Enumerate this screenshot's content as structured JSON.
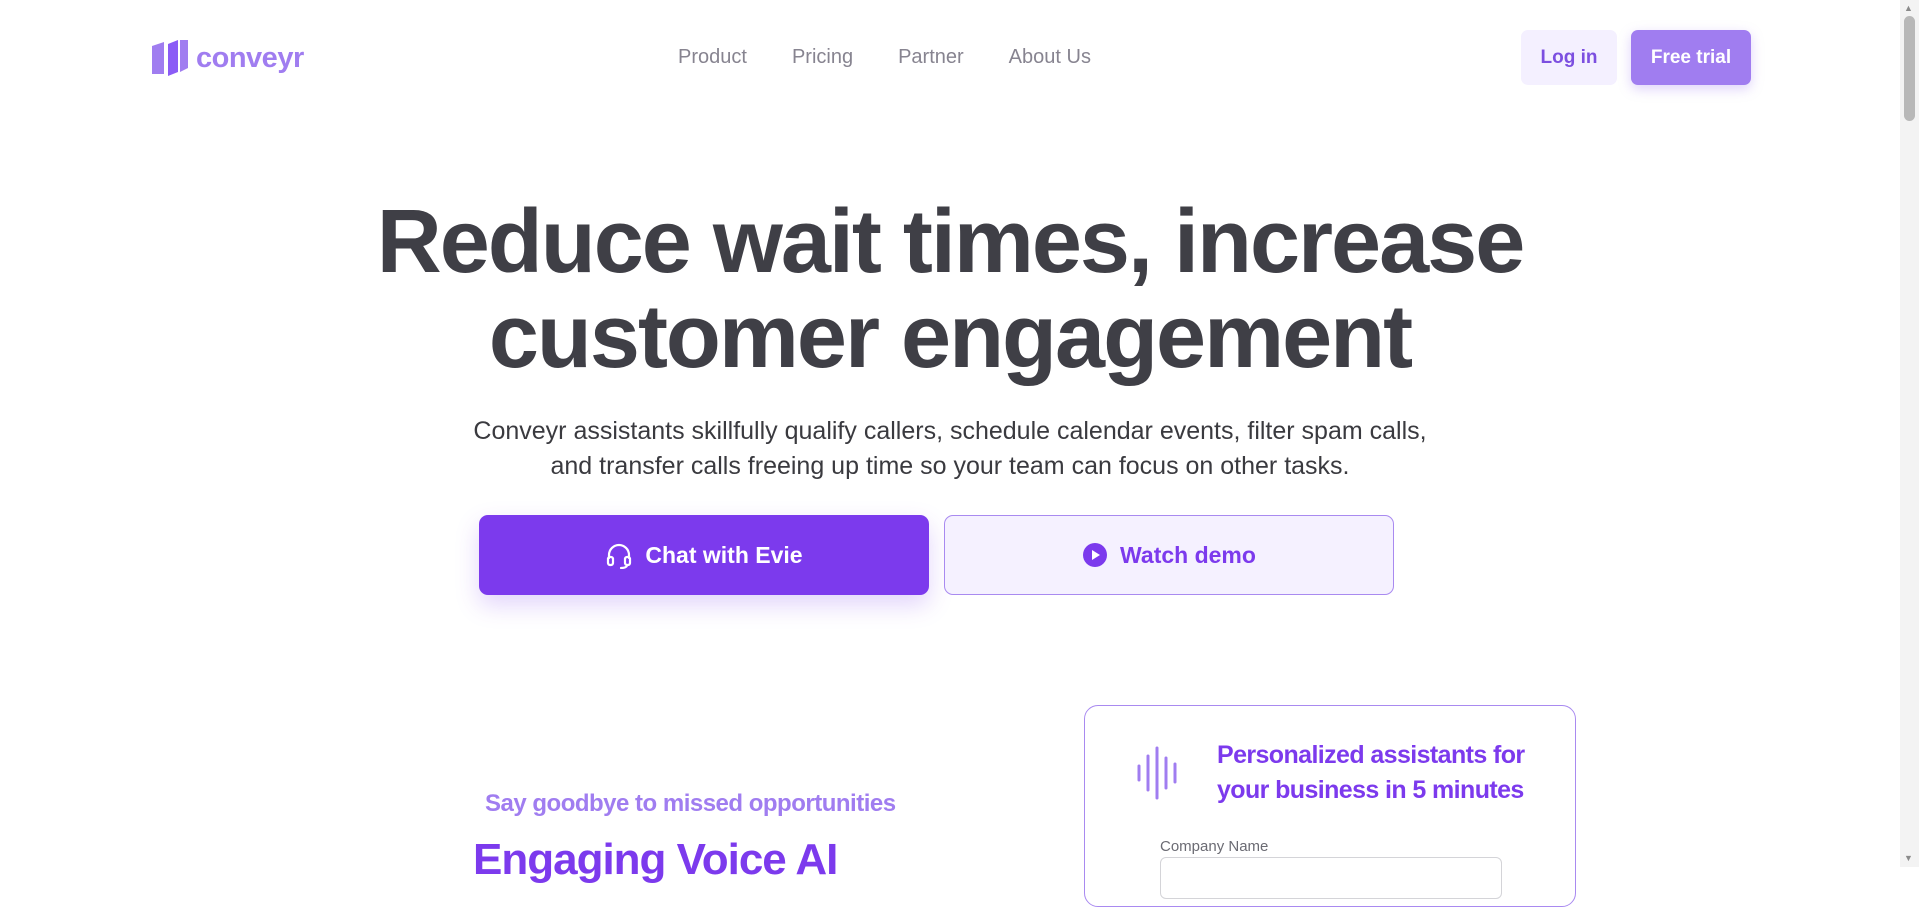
{
  "brand": {
    "name": "conveyr",
    "accent": "#a07df0",
    "primary": "#7c3aed"
  },
  "nav": {
    "items": [
      "Product",
      "Pricing",
      "Partner",
      "About Us"
    ]
  },
  "header": {
    "login_label": "Log in",
    "trial_label": "Free trial"
  },
  "hero": {
    "title_line1": "Reduce wait times, increase",
    "title_line2": "customer engagement",
    "subtitle_line1": "Conveyr assistants skillfully qualify callers, schedule calendar events, filter spam calls,",
    "subtitle_line2": "and transfer calls freeing up time so your team can focus on other tasks.",
    "chat_label": "Chat with Evie",
    "chat_icon": "headset-icon",
    "demo_label": "Watch demo",
    "demo_icon": "play-circle-icon"
  },
  "section": {
    "tagline": "Say goodbye to missed opportunities",
    "title": "Engaging Voice AI"
  },
  "card": {
    "icon": "sound-wave-icon",
    "title": "Personalized assistants for your business in 5 minutes",
    "company_label": "Company Name",
    "company_value": ""
  }
}
